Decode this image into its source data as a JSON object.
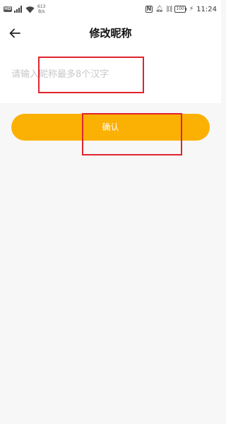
{
  "status_bar": {
    "left_badge": "HD",
    "net_speed_value": "613",
    "net_speed_unit": "B/s",
    "nfc_label": "N",
    "battery_level": "100",
    "time": "11:24",
    "icons": [
      "hd-icon",
      "signal-icon",
      "wifi-icon",
      "nfc-icon",
      "bell-icon",
      "vibrate-icon",
      "battery-icon",
      "charging-icon"
    ]
  },
  "nav": {
    "title": "修改昵称",
    "back_icon": "arrow-left-icon"
  },
  "form": {
    "nickname_placeholder": "请输入昵称最多8个汉字",
    "nickname_value": ""
  },
  "actions": {
    "confirm_label": "确认"
  },
  "colors": {
    "accent": "#fbb104",
    "background": "#f7f7f7",
    "panel": "#ffffff",
    "annotation": "#e0242e",
    "placeholder": "#c8c8c8"
  }
}
